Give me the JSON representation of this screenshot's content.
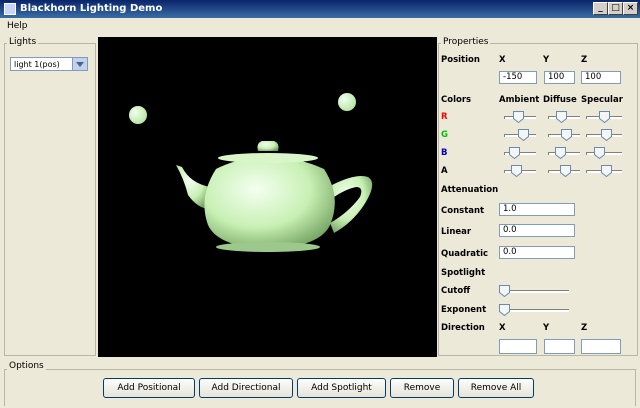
{
  "window": {
    "title": "Blackhorn Lighting Demo",
    "minimize": "_",
    "maximize": "□",
    "close": "×"
  },
  "menu": {
    "help": "Help"
  },
  "lights": {
    "label": "Lights",
    "selected": "light  1(pos)"
  },
  "properties": {
    "label": "Properties",
    "position": {
      "label": "Position",
      "x_header": "X",
      "y_header": "Y",
      "z_header": "Z",
      "x": "-150",
      "y": "100",
      "z": "100"
    },
    "colors": {
      "label": "Colors",
      "ambient_header": "Ambient",
      "diffuse_header": "Diffuse",
      "specular_header": "Specular",
      "r_label": "R",
      "g_label": "G",
      "b_label": "B",
      "a_label": "A",
      "r_color": "#ff0000",
      "g_color": "#00c000",
      "b_color": "#0000c0",
      "levels": {
        "ambient": [
          0.45,
          0.65,
          0.25,
          0.35
        ],
        "diffuse": [
          0.4,
          0.6,
          0.35,
          0.55
        ],
        "specular": [
          0.5,
          0.6,
          0.3,
          0.6
        ]
      }
    },
    "attenuation": {
      "label": "Attenuation",
      "constant_label": "Constant",
      "constant": "1.0",
      "linear_label": "Linear",
      "linear": "0.0",
      "quadratic_label": "Quadratic",
      "quadratic": "0.0"
    },
    "spotlight": {
      "label": "Spotlight",
      "cutoff_label": "Cutoff",
      "cutoff_level": 0.0,
      "exponent_label": "Exponent",
      "exponent_level": 0.0
    },
    "direction": {
      "label": "Direction",
      "x_header": "X",
      "y_header": "Y",
      "z_header": "Z",
      "x": "",
      "y": "",
      "z": ""
    }
  },
  "options": {
    "label": "Options"
  },
  "buttons": {
    "add_positional": "Add Positional",
    "add_directional": "Add Directional",
    "add_spotlight": "Add Spotlight",
    "remove": "Remove",
    "remove_all": "Remove All"
  },
  "scene": {
    "background": "#000000",
    "teapot_color": "#c8f0b4",
    "light_marker_color": "#b4e6a0"
  }
}
